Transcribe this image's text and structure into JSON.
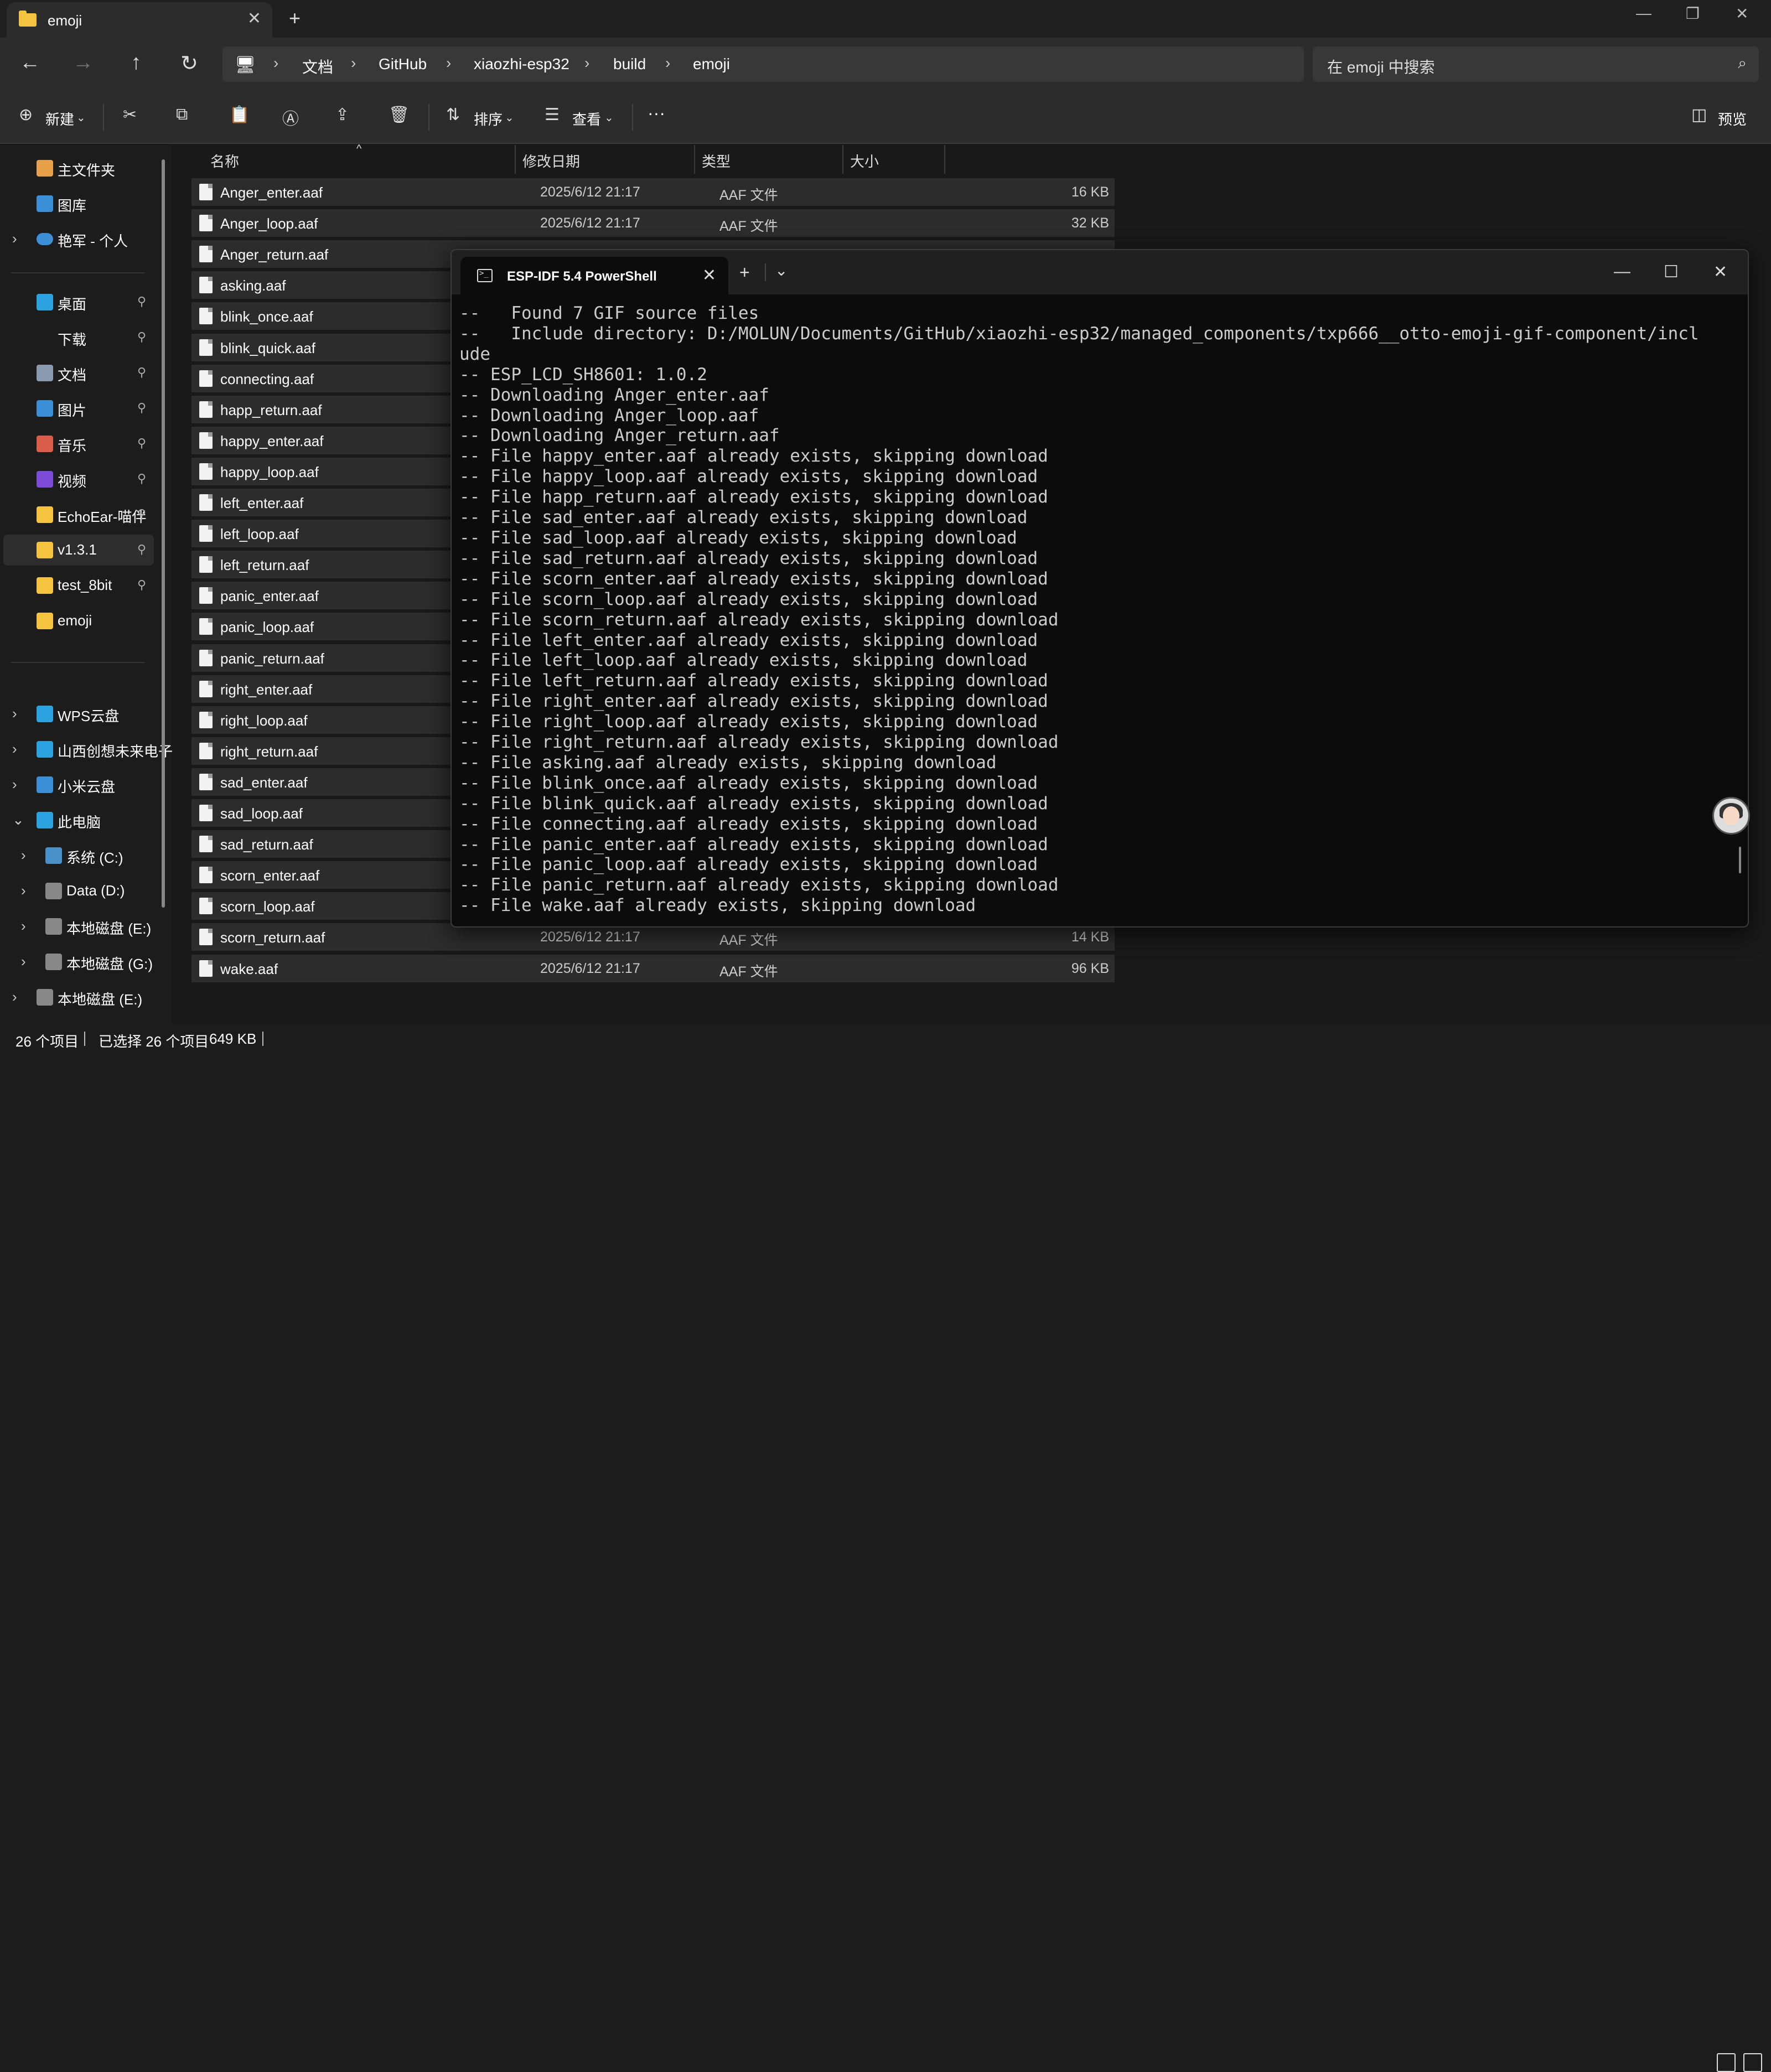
{
  "explorer": {
    "tab_title": "emoji",
    "breadcrumb": [
      "文档",
      "GitHub",
      "xiaozhi-esp32",
      "build",
      "emoji"
    ],
    "search_placeholder": "在 emoji 中搜索",
    "toolbar": {
      "new_label": "新建",
      "sort_label": "排序",
      "view_label": "查看",
      "more_label": "···",
      "preview_label": "预览"
    },
    "sidebar": {
      "quick": [
        {
          "label": "主文件夹",
          "icon": "home-icon",
          "color": "#e8a04a"
        },
        {
          "label": "图库",
          "icon": "gallery-icon",
          "color": "#3a8fd6"
        },
        {
          "label": "艳军 - 个人",
          "icon": "onedrive-icon",
          "color": "#3a8fd6",
          "chevron": "›"
        }
      ],
      "pinned": [
        {
          "label": "桌面",
          "icon": "desktop-icon",
          "color": "#2ba3e0",
          "pin": "📌"
        },
        {
          "label": "下载",
          "icon": "download-icon",
          "color": "#1c1c1c",
          "pin": "📌"
        },
        {
          "label": "文档",
          "icon": "documents-icon",
          "color": "#8a9bb0",
          "pin": "📌"
        },
        {
          "label": "图片",
          "icon": "pictures-icon",
          "color": "#3a8fd6",
          "pin": "📌"
        },
        {
          "label": "音乐",
          "icon": "music-icon",
          "color": "#d95d4a",
          "pin": "📌"
        },
        {
          "label": "视频",
          "icon": "video-icon",
          "color": "#7c4ad6",
          "pin": "📌"
        },
        {
          "label": "EchoEar-喵伴",
          "icon": "folder-icon",
          "color": "#f4c33f",
          "pin": "📌"
        },
        {
          "label": "v1.3.1",
          "icon": "folder-icon",
          "color": "#f4c33f",
          "pin": "📌",
          "selected": true
        },
        {
          "label": "test_8bit",
          "icon": "folder-icon",
          "color": "#f4c33f",
          "pin": "📌"
        },
        {
          "label": "emoji",
          "icon": "folder-icon",
          "color": "#f4c33f"
        }
      ],
      "drives": [
        {
          "label": "WPS云盘",
          "icon": "cloud-icon",
          "color": "#2ba3e0",
          "chevron": "›",
          "indent": 0
        },
        {
          "label": "山西创想未来电子",
          "icon": "phone-icon",
          "color": "#2ba3e0",
          "chevron": "›",
          "indent": 0
        },
        {
          "label": "小米云盘",
          "icon": "cloud-icon",
          "color": "#3a8fd6",
          "chevron": "›",
          "indent": 0
        },
        {
          "label": "此电脑",
          "icon": "computer-icon",
          "color": "#2ba3e0",
          "chevron": "⌄",
          "indent": 0
        },
        {
          "label": "系统 (C:)",
          "icon": "drive-icon",
          "color": "#4a90c8",
          "chevron": "›",
          "indent": 1
        },
        {
          "label": "Data (D:)",
          "icon": "drive-icon",
          "color": "#888888",
          "chevron": "›",
          "indent": 1
        },
        {
          "label": "本地磁盘 (E:)",
          "icon": "drive-icon",
          "color": "#888888",
          "chevron": "›",
          "indent": 1
        },
        {
          "label": "本地磁盘 (G:)",
          "icon": "drive-icon",
          "color": "#888888",
          "chevron": "›",
          "indent": 1
        },
        {
          "label": "本地磁盘 (E:)",
          "icon": "drive-icon",
          "color": "#888888",
          "chevron": "›",
          "indent": 0
        },
        {
          "label": "本地磁盘 (G:)",
          "icon": "drive-icon",
          "color": "#888888",
          "chevron": "›",
          "indent": 0
        }
      ]
    },
    "columns": {
      "name": "名称",
      "date": "修改日期",
      "type": "类型",
      "size": "大小"
    },
    "files": [
      {
        "name": "Anger_enter.aaf",
        "date": "2025/6/12 21:17",
        "type": "AAF 文件",
        "size": "16 KB"
      },
      {
        "name": "Anger_loop.aaf",
        "date": "2025/6/12 21:17",
        "type": "AAF 文件",
        "size": "32 KB"
      },
      {
        "name": "Anger_return.aaf",
        "date": "",
        "type": "",
        "size": ""
      },
      {
        "name": "asking.aaf",
        "date": "",
        "type": "",
        "size": ""
      },
      {
        "name": "blink_once.aaf",
        "date": "",
        "type": "",
        "size": ""
      },
      {
        "name": "blink_quick.aaf",
        "date": "",
        "type": "",
        "size": ""
      },
      {
        "name": "connecting.aaf",
        "date": "",
        "type": "",
        "size": ""
      },
      {
        "name": "happ_return.aaf",
        "date": "",
        "type": "",
        "size": ""
      },
      {
        "name": "happy_enter.aaf",
        "date": "",
        "type": "",
        "size": ""
      },
      {
        "name": "happy_loop.aaf",
        "date": "",
        "type": "",
        "size": ""
      },
      {
        "name": "left_enter.aaf",
        "date": "",
        "type": "",
        "size": ""
      },
      {
        "name": "left_loop.aaf",
        "date": "",
        "type": "",
        "size": ""
      },
      {
        "name": "left_return.aaf",
        "date": "",
        "type": "",
        "size": ""
      },
      {
        "name": "panic_enter.aaf",
        "date": "",
        "type": "",
        "size": ""
      },
      {
        "name": "panic_loop.aaf",
        "date": "",
        "type": "",
        "size": ""
      },
      {
        "name": "panic_return.aaf",
        "date": "",
        "type": "",
        "size": ""
      },
      {
        "name": "right_enter.aaf",
        "date": "",
        "type": "",
        "size": ""
      },
      {
        "name": "right_loop.aaf",
        "date": "",
        "type": "",
        "size": ""
      },
      {
        "name": "right_return.aaf",
        "date": "",
        "type": "",
        "size": ""
      },
      {
        "name": "sad_enter.aaf",
        "date": "",
        "type": "",
        "size": ""
      },
      {
        "name": "sad_loop.aaf",
        "date": "",
        "type": "",
        "size": ""
      },
      {
        "name": "sad_return.aaf",
        "date": "",
        "type": "",
        "size": ""
      },
      {
        "name": "scorn_enter.aaf",
        "date": "",
        "type": "",
        "size": ""
      },
      {
        "name": "scorn_loop.aaf",
        "date": "",
        "type": "",
        "size": ""
      },
      {
        "name": "scorn_return.aaf",
        "date": "2025/6/12 21:17",
        "type": "AAF 文件",
        "size": "14 KB"
      },
      {
        "name": "wake.aaf",
        "date": "2025/6/12 21:17",
        "type": "AAF 文件",
        "size": "96 KB"
      }
    ],
    "status": {
      "count": "26 个项目",
      "selected": "已选择 26 个项目",
      "size": "649 KB"
    }
  },
  "terminal": {
    "tab_title": "ESP-IDF 5.4 PowerShell",
    "lines": [
      "--   Found 7 GIF source files",
      "--   Include directory: D:/MOLUN/Documents/GitHub/xiaozhi-esp32/managed_components/txp666__otto-emoji-gif-component/incl",
      "ude",
      "-- ESP_LCD_SH8601: 1.0.2",
      "-- Downloading Anger_enter.aaf",
      "-- Downloading Anger_loop.aaf",
      "-- Downloading Anger_return.aaf",
      "-- File happy_enter.aaf already exists, skipping download",
      "-- File happy_loop.aaf already exists, skipping download",
      "-- File happ_return.aaf already exists, skipping download",
      "-- File sad_enter.aaf already exists, skipping download",
      "-- File sad_loop.aaf already exists, skipping download",
      "-- File sad_return.aaf already exists, skipping download",
      "-- File scorn_enter.aaf already exists, skipping download",
      "-- File scorn_loop.aaf already exists, skipping download",
      "-- File scorn_return.aaf already exists, skipping download",
      "-- File left_enter.aaf already exists, skipping download",
      "-- File left_loop.aaf already exists, skipping download",
      "-- File left_return.aaf already exists, skipping download",
      "-- File right_enter.aaf already exists, skipping download",
      "-- File right_loop.aaf already exists, skipping download",
      "-- File right_return.aaf already exists, skipping download",
      "-- File asking.aaf already exists, skipping download",
      "-- File blink_once.aaf already exists, skipping download",
      "-- File blink_quick.aaf already exists, skipping download",
      "-- File connecting.aaf already exists, skipping download",
      "-- File panic_enter.aaf already exists, skipping download",
      "-- File panic_loop.aaf already exists, skipping download",
      "-- File panic_return.aaf already exists, skipping download",
      "-- File wake.aaf already exists, skipping download"
    ]
  }
}
